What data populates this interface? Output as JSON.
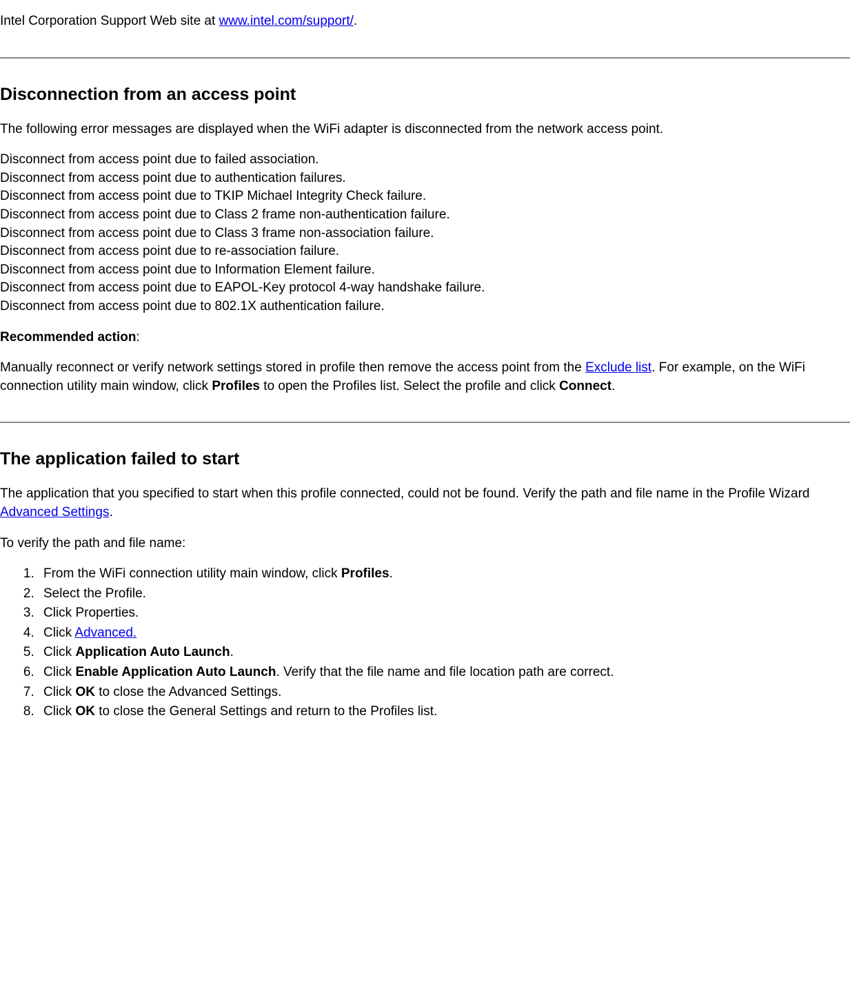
{
  "intro": {
    "prefix": "Intel Corporation Support Web site at ",
    "link_text": "www.intel.com/support/",
    "suffix": "."
  },
  "section1": {
    "heading": "Disconnection from an access point",
    "intro": "The following error messages are displayed when the WiFi adapter is disconnected from the network access point.",
    "errors": [
      "Disconnect from access point due to failed association.",
      "Disconnect from access point due to authentication failures.",
      "Disconnect from access point due to TKIP Michael Integrity Check failure.",
      "Disconnect from access point due to Class 2 frame non-authentication failure.",
      "Disconnect from access point due to Class 3 frame non-association failure.",
      "Disconnect from access point due to re-association failure.",
      "Disconnect from access point due to Information Element failure.",
      "Disconnect from access point due to EAPOL-Key protocol 4-way handshake failure.",
      "Disconnect from access point due to 802.1X authentication failure."
    ],
    "rec_label": "Recommended action",
    "rec_colon": ":",
    "rec_pre": "Manually reconnect or verify network settings stored in profile then remove the access point from the ",
    "rec_link": "Exclude list",
    "rec_mid1": ". For example, on the WiFi connection utility main window, click ",
    "rec_profiles": "Profiles",
    "rec_mid2": " to open the Profiles list. Select the profile and click ",
    "rec_connect": "Connect",
    "rec_end": "."
  },
  "section2": {
    "heading": "The application failed to start",
    "intro_pre": "The application that you specified to start when this profile connected, could not be found. Verify the path and file name in the Profile Wizard ",
    "intro_link": "Advanced Settings",
    "intro_end": ".",
    "verify_label": "To verify the path and file name:",
    "step1_pre": "From the WiFi connection utility main window, click ",
    "step1_bold": "Profiles",
    "step1_end": ".",
    "step2": "Select the Profile.",
    "step3": "Click Properties.",
    "step4_pre": "Click ",
    "step4_link": "Advanced.",
    "step5_pre": "Click ",
    "step5_bold": "Application Auto Launch",
    "step5_end": ".",
    "step6_pre": "Click ",
    "step6_bold": "Enable Application Auto Launch",
    "step6_end": ". Verify that the file name and file location path are correct.",
    "step7_pre": "Click ",
    "step7_bold": "OK",
    "step7_end": " to close the Advanced Settings.",
    "step8_pre": "Click ",
    "step8_bold": "OK",
    "step8_end": " to close the General Settings and return to the Profiles list."
  }
}
